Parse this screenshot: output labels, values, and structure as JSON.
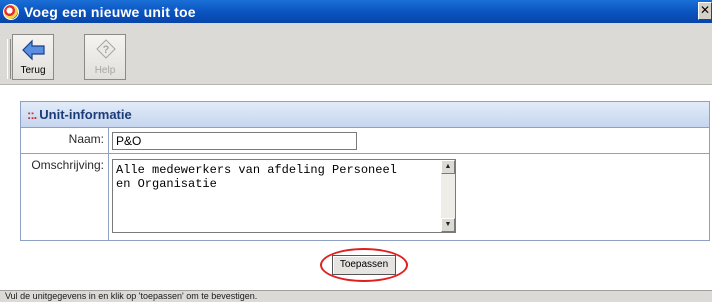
{
  "window": {
    "title": "Voeg een nieuwe unit toe",
    "close_glyph": "✕"
  },
  "toolbar": {
    "back_label": "Terug",
    "help_label": "Help",
    "back_icon": "arrow-left-icon",
    "help_icon": "question-icon"
  },
  "panel": {
    "dots": "::.",
    "title": "Unit-informatie",
    "fields": {
      "naam_label": "Naam:",
      "naam_value": "P&O",
      "omschrijving_label": "Omschrijving:",
      "omschrijving_value": "Alle medewerkers van afdeling Personeel\nen Organisatie"
    }
  },
  "actions": {
    "apply_label": "Toepassen"
  },
  "status": {
    "text": "Vul de unitgegevens in en klik op 'toepassen' om te bevestigen."
  },
  "colors": {
    "titlebar": "#0a52be",
    "panel_header": "#c6d6ef",
    "highlight": "#e02020"
  }
}
